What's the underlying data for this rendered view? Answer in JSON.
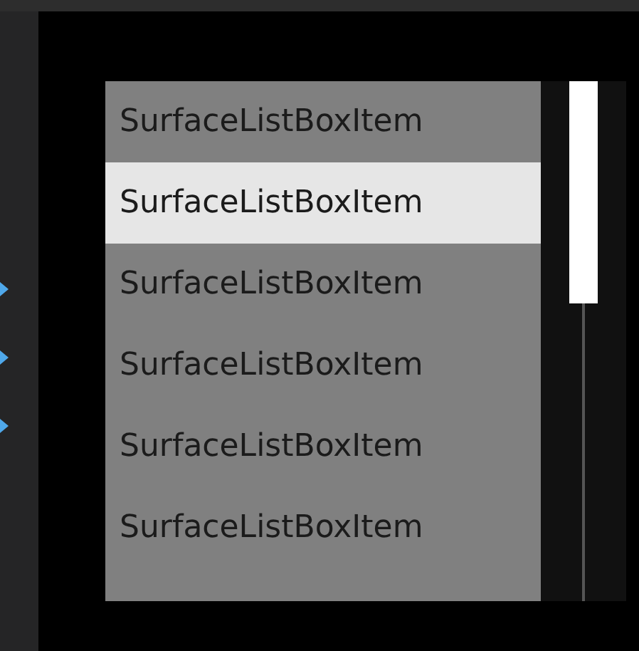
{
  "list": {
    "items": [
      {
        "label": "SurfaceListBoxItem",
        "selected": false
      },
      {
        "label": "SurfaceListBoxItem",
        "selected": true
      },
      {
        "label": "SurfaceListBoxItem",
        "selected": false
      },
      {
        "label": "SurfaceListBoxItem",
        "selected": false
      },
      {
        "label": "SurfaceListBoxItem",
        "selected": false
      },
      {
        "label": "SurfaceListBoxItem",
        "selected": false
      }
    ]
  }
}
